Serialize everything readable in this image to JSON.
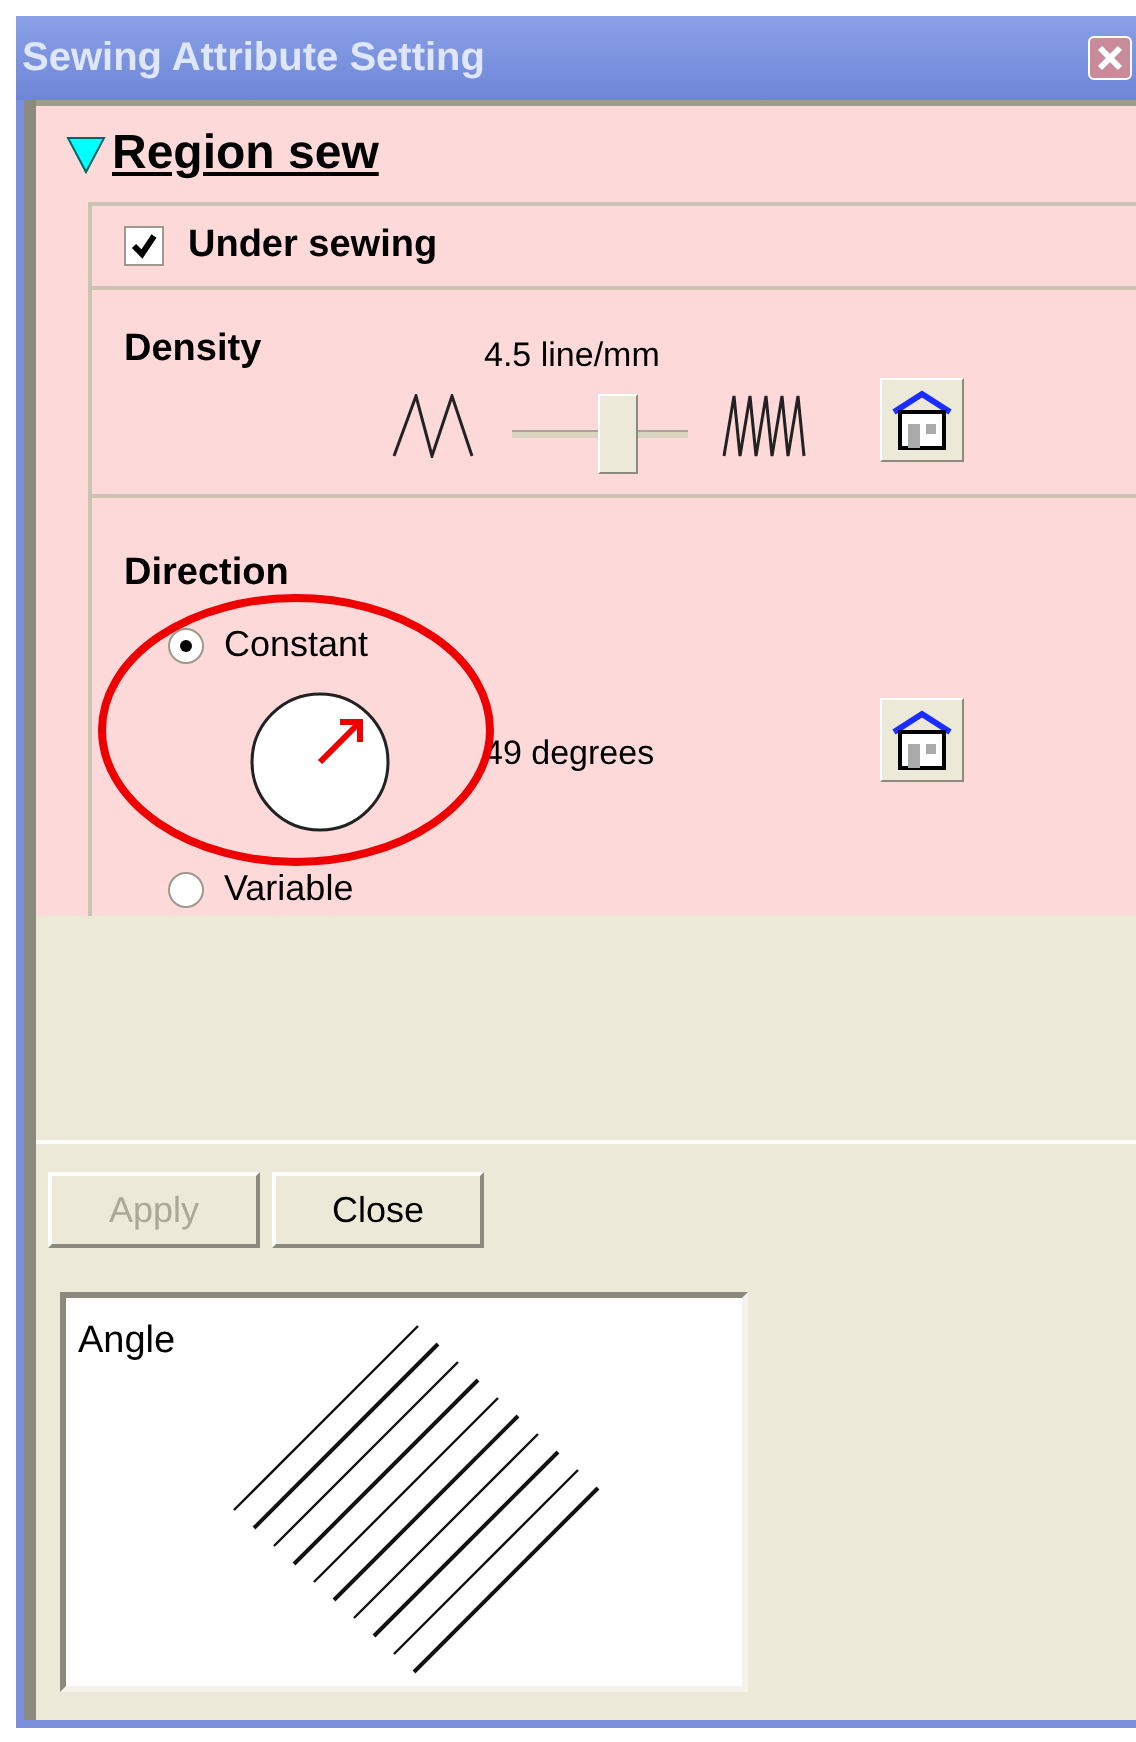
{
  "window": {
    "title": "Sewing Attribute Setting"
  },
  "section": {
    "title": "Region sew",
    "expanded": true
  },
  "under_sewing": {
    "label": "Under sewing",
    "checked": true
  },
  "density": {
    "label": "Density",
    "reading": "4.5 line/mm",
    "level": 0.6
  },
  "direction": {
    "label": "Direction",
    "reading": "49 degrees",
    "options": [
      {
        "label": "Constant",
        "selected": true
      },
      {
        "label": "Variable",
        "selected": false
      }
    ]
  },
  "buttons": [
    {
      "label": "Apply",
      "disabled": true
    },
    {
      "label": "Close",
      "disabled": false
    }
  ],
  "preview": {
    "label": "Angle"
  }
}
